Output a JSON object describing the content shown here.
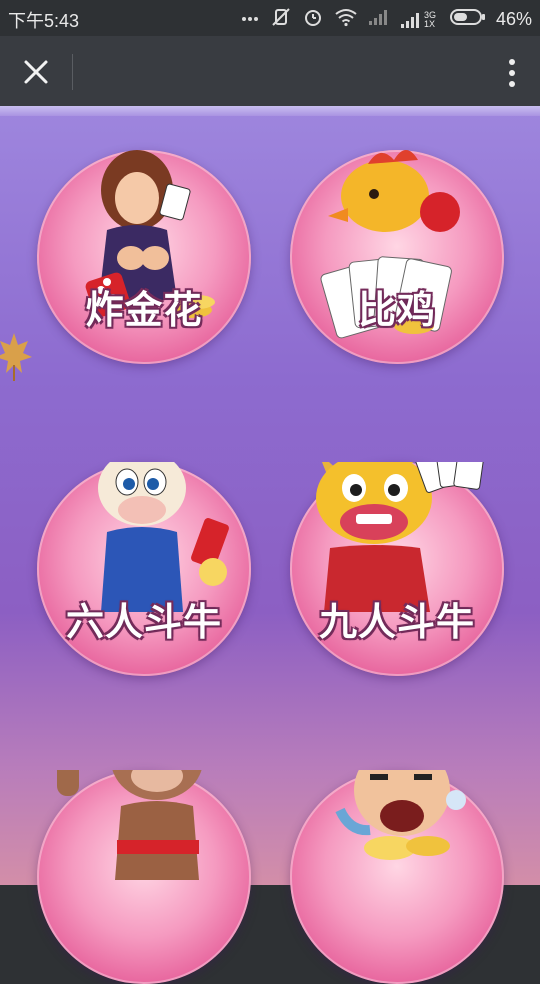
{
  "status_bar": {
    "time": "下午5:43",
    "network": "3G 1X",
    "battery": "46%"
  },
  "top_bar": {
    "close_icon": "close-icon",
    "menu_icon": "more-vertical-icon"
  },
  "games": [
    {
      "name": "炸金花",
      "icon": "poker-woman-dice-icon"
    },
    {
      "name": "比鸡",
      "icon": "rooster-playing-cards-icon"
    },
    {
      "name": "六人斗牛",
      "icon": "cartoon-bull-firecracker-icon"
    },
    {
      "name": "九人斗牛",
      "icon": "cartoon-bull-cards-icon"
    },
    {
      "name": "",
      "icon": "muscle-bull-gold-ingot-icon"
    },
    {
      "name": "",
      "icon": "man-gold-coins-icon"
    }
  ],
  "colors": {
    "status_bar_bg": "#2e3134",
    "top_bar_bg": "#393c41",
    "content_top": "#9e86de",
    "content_bottom": "#d38ea8",
    "circle_pink": "#e55b97"
  }
}
